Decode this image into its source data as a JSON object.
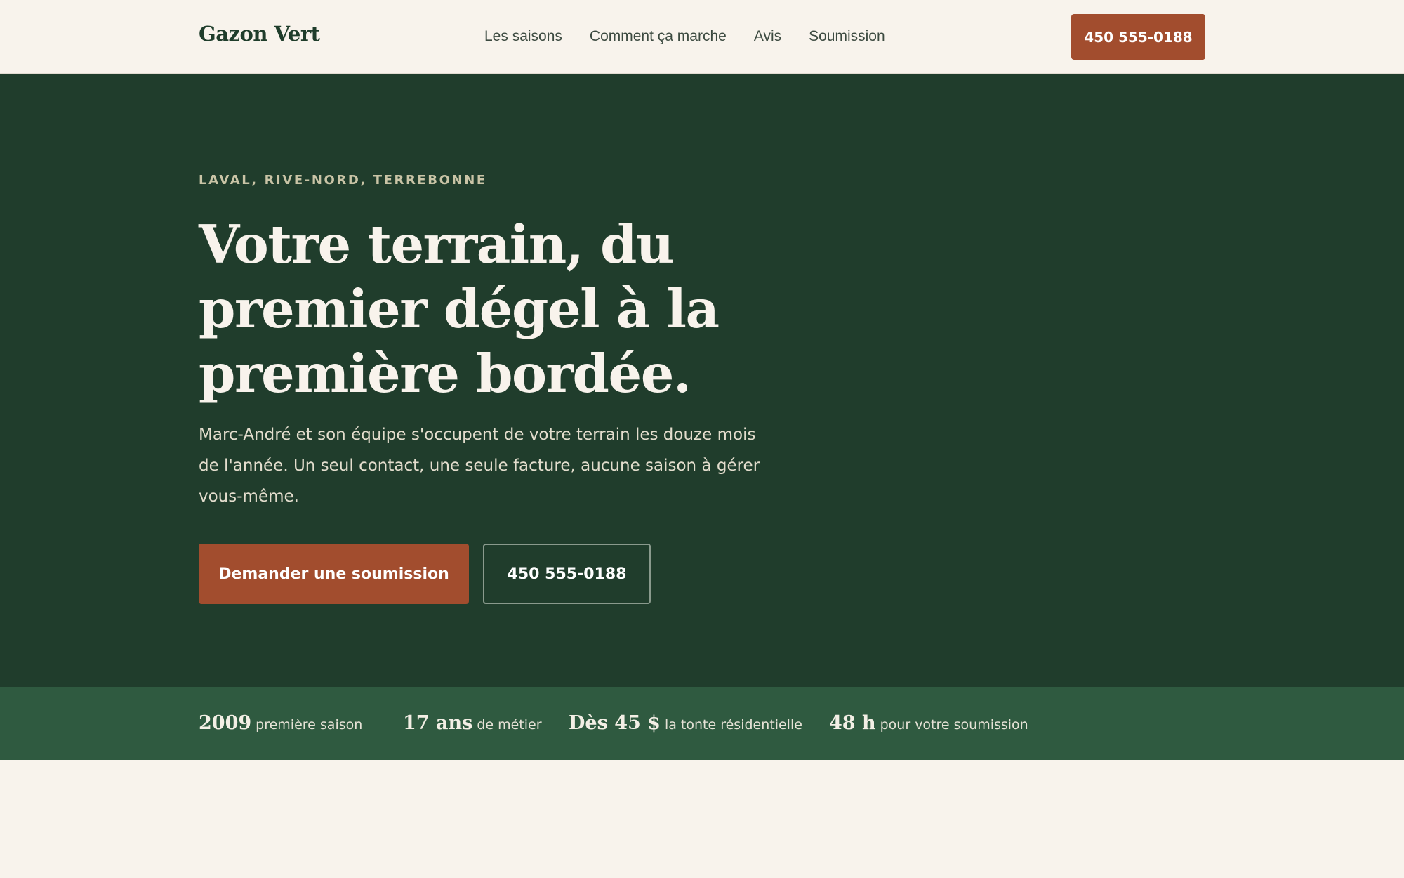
{
  "header": {
    "brand": "Gazon Vert",
    "nav": [
      "Les saisons",
      "Comment ça marche",
      "Avis",
      "Soumission"
    ],
    "phone": "450 555-0188"
  },
  "hero": {
    "eyebrow": "LAVAL, RIVE-NORD, TERREBONNE",
    "headline": "Votre terrain, du premier dégel à la première bordée.",
    "lede": "Marc-André et son équipe s'occupent de votre terrain les douze mois de l'année. Un seul contact, une seule facture, aucune saison à gérer vous-même.",
    "cta_primary": "Demander une soumission",
    "cta_secondary": "450 555-0188"
  },
  "stats": [
    {
      "value": "2009",
      "label": "première saison"
    },
    {
      "value": "17 ans",
      "label": "de métier"
    },
    {
      "value": "Dès 45 $",
      "label": "la tonte résidentielle"
    },
    {
      "value": "48 h",
      "label": "pour votre soumission"
    }
  ],
  "colors": {
    "background": "#f8f3ec",
    "hero": "#203d2c",
    "stats_band": "#2f5a40",
    "accent": "#a24d2e"
  }
}
